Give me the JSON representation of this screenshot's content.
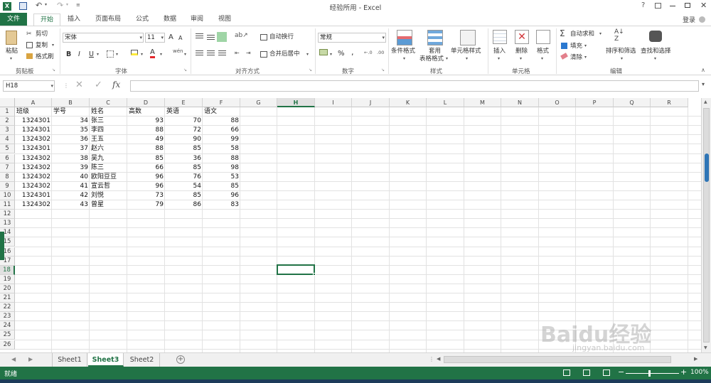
{
  "app": {
    "title": "经验所用 - Excel",
    "login": "登录",
    "help": "?"
  },
  "tabs": [
    "文件",
    "开始",
    "插入",
    "页面布局",
    "公式",
    "数据",
    "审阅",
    "视图"
  ],
  "ribbon": {
    "clipboard": {
      "paste": "粘贴",
      "cut": "剪切",
      "copy": "复制",
      "format_painter": "格式刷",
      "label": "剪贴板"
    },
    "font": {
      "name": "宋体",
      "size": "11",
      "bold": "B",
      "italic": "I",
      "underline": "U",
      "grow": "A",
      "shrink": "A",
      "label": "字体"
    },
    "alignment": {
      "wrap": "自动换行",
      "merge": "合并后居中",
      "label": "对齐方式"
    },
    "number": {
      "format": "常规",
      "percent": "%",
      "comma": ",",
      "label": "数字"
    },
    "styles": {
      "conditional": "条件格式",
      "table1": "套用",
      "table2": "表格格式",
      "cell_styles": "单元格样式",
      "label": "样式"
    },
    "cells": {
      "insert": "插入",
      "delete": "删除",
      "format": "格式",
      "label": "单元格"
    },
    "editing": {
      "autosum": "自动求和",
      "fill": "填充",
      "clear": "清除",
      "sort": "排序和筛选",
      "find": "查找和选择",
      "label": "编辑"
    }
  },
  "formula_bar": {
    "name_box": "H18",
    "fx": "fx",
    "value": ""
  },
  "columns": [
    "A",
    "B",
    "C",
    "D",
    "E",
    "F",
    "G",
    "H",
    "I",
    "J",
    "K",
    "L",
    "M",
    "N",
    "O",
    "P",
    "Q",
    "R"
  ],
  "selected_column": "H",
  "selected_row": "18",
  "rows": [
    "1",
    "2",
    "3",
    "4",
    "5",
    "6",
    "7",
    "8",
    "9",
    "10",
    "11",
    "12",
    "13",
    "14",
    "15",
    "16",
    "17",
    "18",
    "19",
    "20",
    "21",
    "22",
    "23",
    "24",
    "25",
    "26"
  ],
  "table": {
    "headers": [
      "班级",
      "学号",
      "姓名",
      "高数",
      "英语",
      "语文"
    ],
    "data": [
      [
        "1324301",
        "34",
        "张三",
        "93",
        "70",
        "88"
      ],
      [
        "1324301",
        "35",
        "李四",
        "88",
        "72",
        "66"
      ],
      [
        "1324302",
        "36",
        "王五",
        "49",
        "90",
        "99"
      ],
      [
        "1324301",
        "37",
        "赵六",
        "88",
        "85",
        "58"
      ],
      [
        "1324302",
        "38",
        "吴九",
        "85",
        "36",
        "88"
      ],
      [
        "1324302",
        "39",
        "陈三",
        "66",
        "85",
        "98"
      ],
      [
        "1324302",
        "40",
        "欧阳豆豆",
        "96",
        "76",
        "53"
      ],
      [
        "1324302",
        "41",
        "宣云哲",
        "96",
        "54",
        "85"
      ],
      [
        "1324301",
        "42",
        "刘悦",
        "73",
        "85",
        "96"
      ],
      [
        "1324302",
        "43",
        "曾星",
        "79",
        "86",
        "83"
      ]
    ]
  },
  "sheets": [
    "Sheet1",
    "Sheet3",
    "Sheet2"
  ],
  "active_sheet": "Sheet3",
  "status": {
    "ready": "就绪",
    "zoom": "100%"
  },
  "watermark": {
    "brand": "Baidu经验",
    "url": "jingyan.baidu.com"
  }
}
